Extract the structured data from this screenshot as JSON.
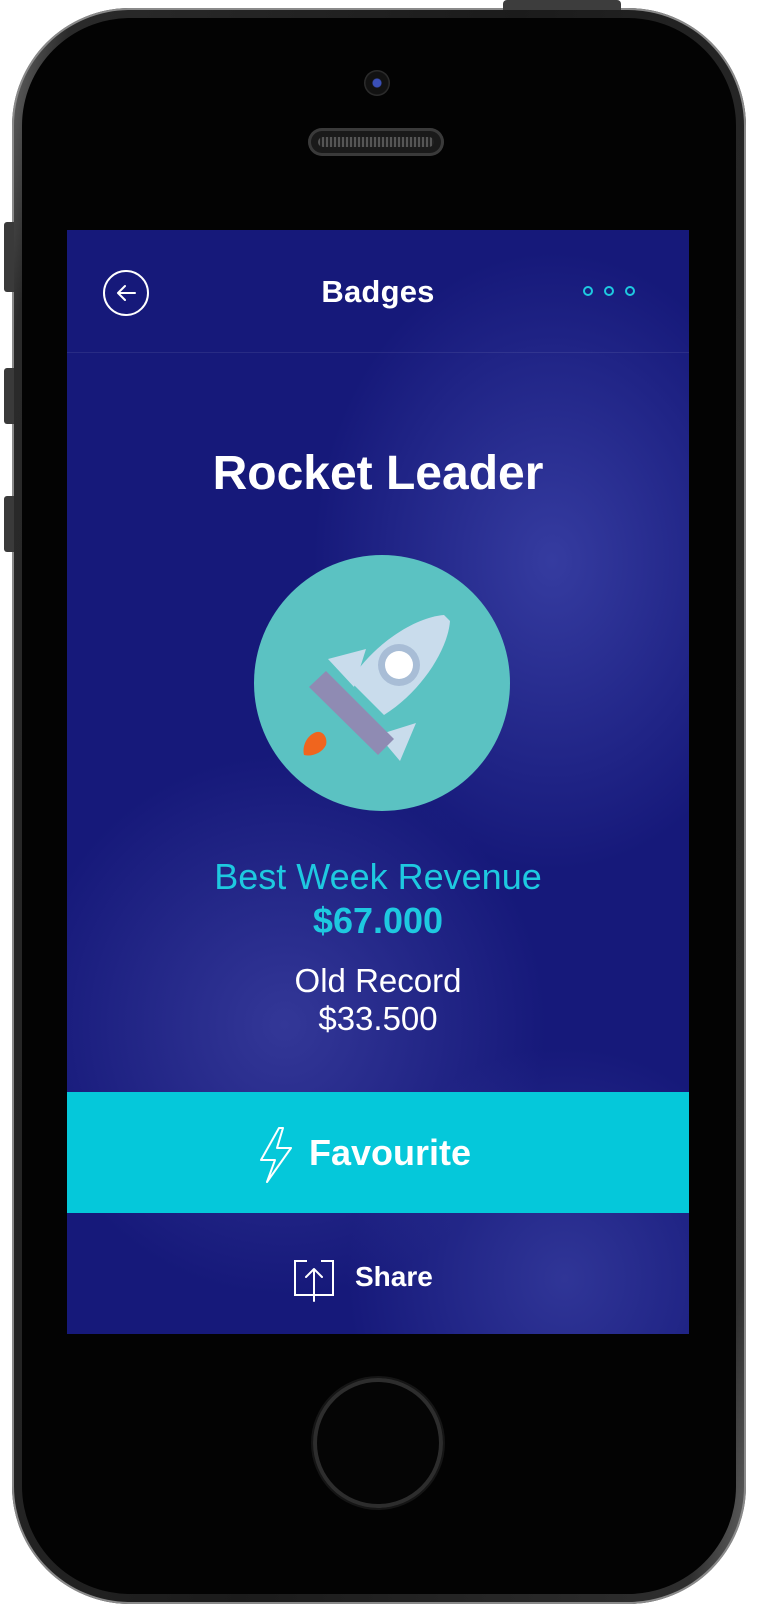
{
  "navbar": {
    "title": "Badges",
    "back_icon": "arrow-left-icon",
    "more_icon": "more-dots-icon"
  },
  "badge": {
    "title": "Rocket Leader",
    "icon": "rocket-icon"
  },
  "metric": {
    "label": "Best Week Revenue",
    "value": "$67.000"
  },
  "old_record": {
    "label": "Old Record",
    "value": "$33.500"
  },
  "actions": {
    "favourite_label": "Favourite",
    "favourite_icon": "lightning-icon",
    "share_label": "Share",
    "share_icon": "share-icon"
  },
  "colors": {
    "background": "#16197a",
    "accent": "#05c8da",
    "badge_circle": "#5bc2c2",
    "flame": "#f0651e"
  }
}
